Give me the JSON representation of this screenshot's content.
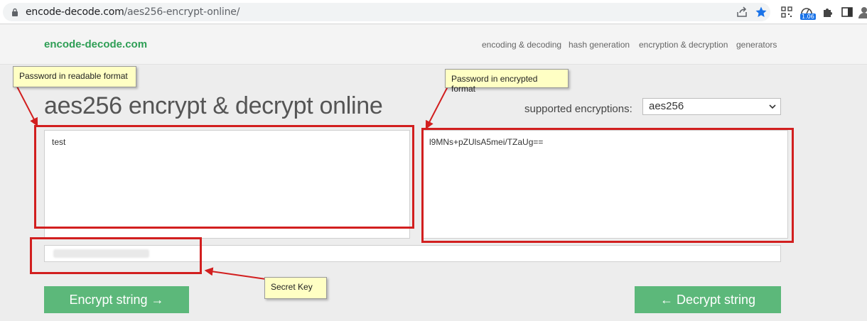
{
  "browser": {
    "url_domain": "encode-decode.com",
    "url_path": "/aes256-encrypt-online/",
    "extension_badge": "1.06",
    "icons": [
      "lock-icon",
      "share-icon",
      "star-icon",
      "qr-icon",
      "extension-badge-icon",
      "puzzle-icon",
      "sidebar-icon",
      "profile-icon"
    ]
  },
  "header": {
    "logo": "encode-decode.com",
    "nav": [
      "encoding & decoding",
      "hash generation",
      "encryption & decryption",
      "generators"
    ]
  },
  "main": {
    "title": "aes256 encrypt & decrypt online",
    "encryption_label": "supported encryptions:",
    "encryption_selected": "aes256",
    "input_text": "test",
    "output_text": "l9MNs+pZUlsA5mei/TZaUg==",
    "encrypt_button": "Encrypt string →",
    "decrypt_button": "← Decrypt string"
  },
  "annotations": {
    "readable": "Password in readable format",
    "encrypted": "Password in encrypted format",
    "secret": "Secret Key"
  },
  "colors": {
    "accent_green": "#5cb87a",
    "logo_green": "#2e9e55",
    "annotation_red": "#d21f1f",
    "callout_yellow": "#ffffc4"
  }
}
